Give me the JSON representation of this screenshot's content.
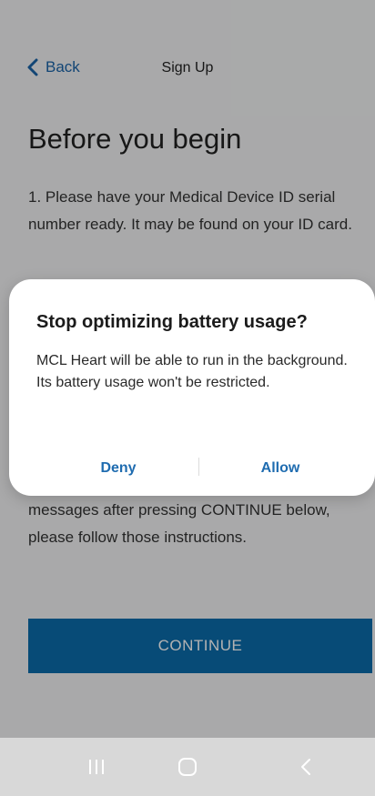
{
  "header": {
    "back_label": "Back",
    "title": "Sign Up"
  },
  "content": {
    "heading": "Before you begin",
    "paragraph_1": "1. Please have your Medical Device ID serial number ready. It may be found on your ID card.",
    "paragraph_2": "messages after pressing CONTINUE below, please follow those instructions.",
    "continue_label": "CONTINUE"
  },
  "dialog": {
    "title": "Stop optimizing battery usage?",
    "message": "MCL Heart will be able to run in the background. Its battery usage won't be restricted.",
    "deny_label": "Deny",
    "allow_label": "Allow"
  },
  "navbar": {
    "icons": [
      "recent-apps-icon",
      "home-icon",
      "back-icon"
    ]
  },
  "colors": {
    "accent": "#0b6cab",
    "link": "#1a63a8",
    "dialog_button": "#1f6cb0"
  }
}
